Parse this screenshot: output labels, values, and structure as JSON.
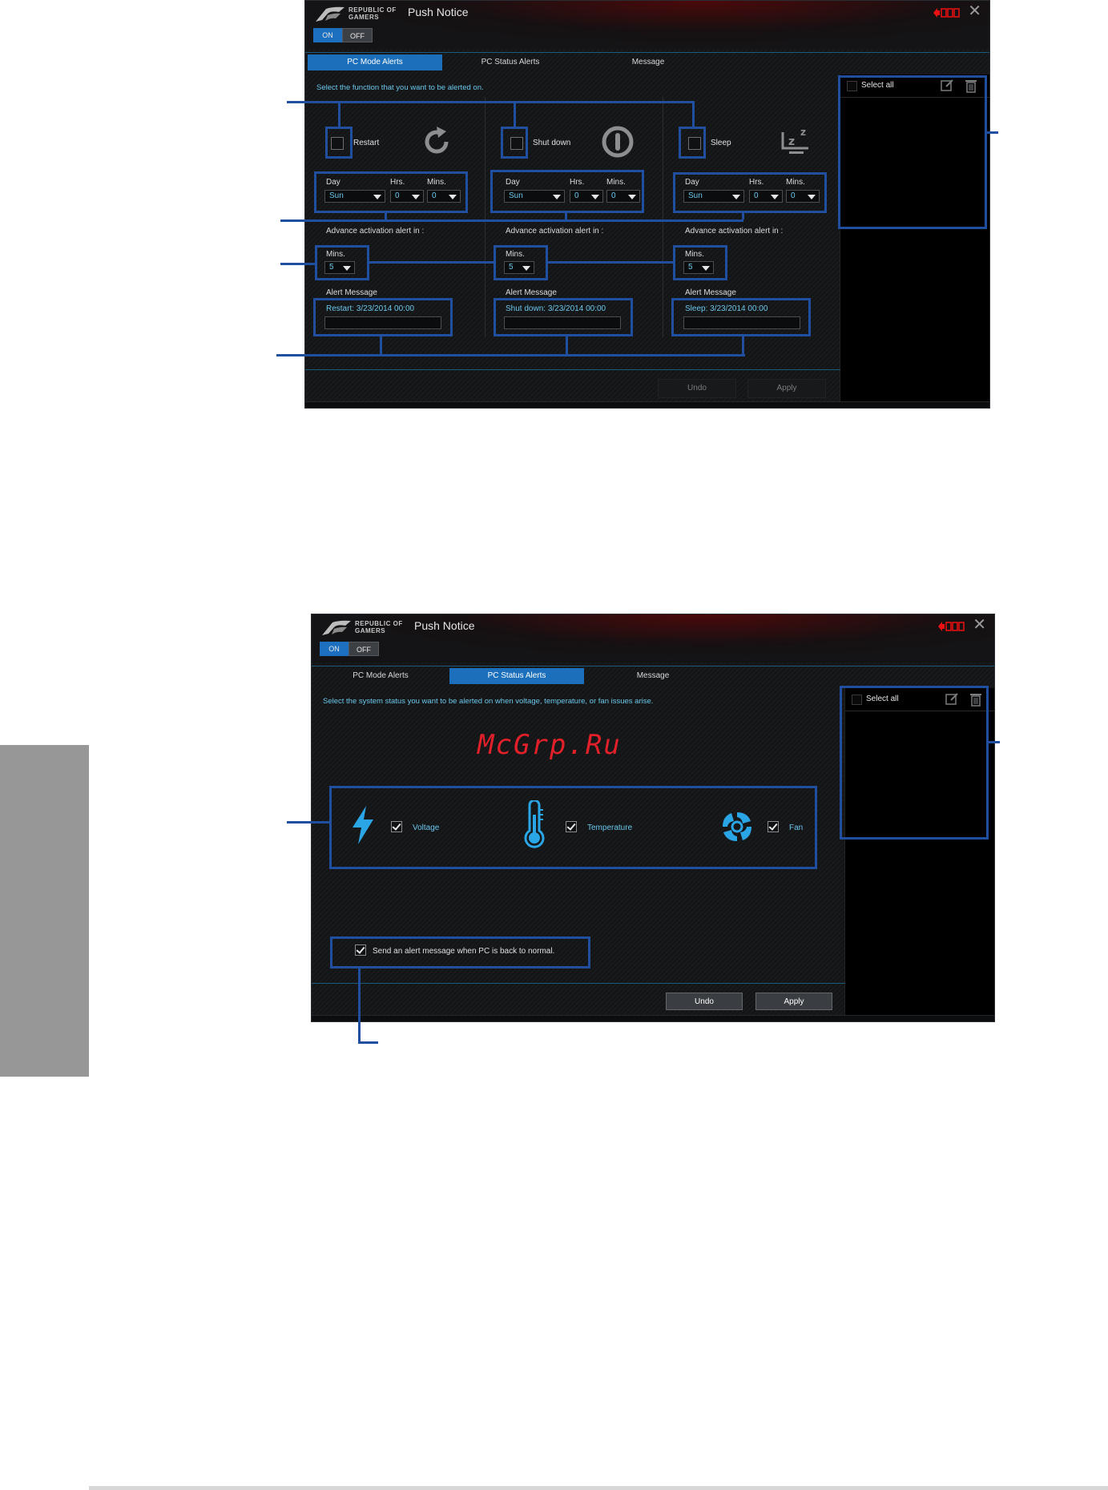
{
  "window1": {
    "brand_line1": "REPUBLIC OF",
    "brand_line2": "GAMERS",
    "title": "Push Notice",
    "toggle": {
      "on": "ON",
      "off": "OFF"
    },
    "tabs": [
      "PC Mode Alerts",
      "PC Status Alerts",
      "Message"
    ],
    "active_tab": "PC Mode Alerts",
    "instruction": "Select the function that you want to be alerted on.",
    "options": [
      {
        "label": "Restart",
        "icon": "restart-icon",
        "day": "Sun",
        "hrs": "0",
        "mins": "0",
        "advance_mins": "5",
        "message": "Restart: 3/23/2014 00:00"
      },
      {
        "label": "Shut down",
        "icon": "power-icon",
        "day": "Sun",
        "hrs": "0",
        "mins": "0",
        "advance_mins": "5",
        "message": "Shut down: 3/23/2014 00:00"
      },
      {
        "label": "Sleep",
        "icon": "sleep-icon",
        "day": "Sun",
        "hrs": "0",
        "mins": "0",
        "advance_mins": "5",
        "message": "Sleep: 3/23/2014 00:00"
      }
    ],
    "labels": {
      "day": "Day",
      "hrs": "Hrs.",
      "mins": "Mins.",
      "advance": "Advance activation alert in :",
      "alert_message": "Alert Message"
    },
    "right_panel": {
      "select_all": "Select all"
    },
    "buttons": {
      "undo": "Undo",
      "apply": "Apply"
    }
  },
  "window2": {
    "brand_line1": "REPUBLIC OF",
    "brand_line2": "GAMERS",
    "title": "Push Notice",
    "toggle": {
      "on": "ON",
      "off": "OFF"
    },
    "tabs": [
      "PC Mode Alerts",
      "PC Status Alerts",
      "Message"
    ],
    "active_tab": "PC Status Alerts",
    "instruction": "Select the system status you want to be alerted on when voltage, temperature, or fan issues arise.",
    "status_items": [
      {
        "label": "Voltage",
        "icon": "lightning-icon",
        "checked": true
      },
      {
        "label": "Temperature",
        "icon": "thermometer-icon",
        "checked": true
      },
      {
        "label": "Fan",
        "icon": "fan-icon",
        "checked": true
      }
    ],
    "back_to_normal": "Send an alert message when PC is back to normal.",
    "right_panel": {
      "select_all": "Select all"
    },
    "buttons": {
      "undo": "Undo",
      "apply": "Apply"
    }
  },
  "watermark": "McGrp.Ru",
  "colors": {
    "accent_blue": "#1b6fbb",
    "value_cyan": "#6cc7ec",
    "callout_blue": "#1f4f9e",
    "watermark_red": "#e2202a"
  }
}
